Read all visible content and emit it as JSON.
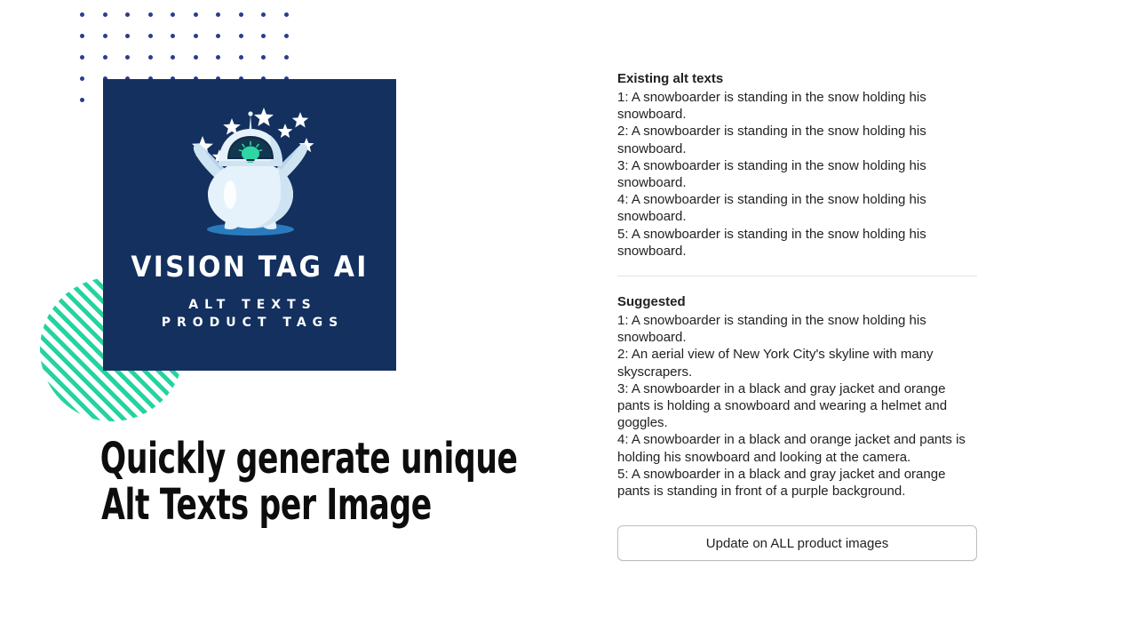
{
  "promo": {
    "brand_title": "VISION TAG AI",
    "brand_subtitle_1": "ALT TEXTS",
    "brand_subtitle_2": "PRODUCT TAGS",
    "headline_line_1": "Quickly generate unique",
    "headline_line_2": "Alt Texts per Image",
    "colors": {
      "card_navy": "#13305f",
      "accent_green": "#25d3a0",
      "dot_blue": "#2b3c8c",
      "robot_body": "#e6f2fb",
      "robot_shade": "#b9d4e8",
      "visor_dark": "#122b45",
      "shadow_blue": "#2a7bbd"
    }
  },
  "alt_panel": {
    "existing": {
      "heading": "Existing alt texts",
      "items": [
        "1: A snowboarder is standing in the snow holding his snowboard.",
        "2: A snowboarder is standing in the snow holding his snowboard.",
        "3: A snowboarder is standing in the snow holding his snowboard.",
        "4: A snowboarder is standing in the snow holding his snowboard.",
        "5: A snowboarder is standing in the snow holding his snowboard."
      ]
    },
    "suggested": {
      "heading": "Suggested",
      "items": [
        "1: A snowboarder is standing in the snow holding his snowboard.",
        "2: An aerial view of New York City's skyline with many skyscrapers.",
        "3: A snowboarder in a black and gray jacket and orange pants is holding a snowboard and wearing a helmet and goggles.",
        "4: A snowboarder in a black and orange jacket and pants is holding his snowboard and looking at the camera.",
        "5: A snowboarder in a black and gray jacket and orange pants is standing in front of a purple background."
      ]
    },
    "update_button_label": "Update on ALL product images"
  }
}
